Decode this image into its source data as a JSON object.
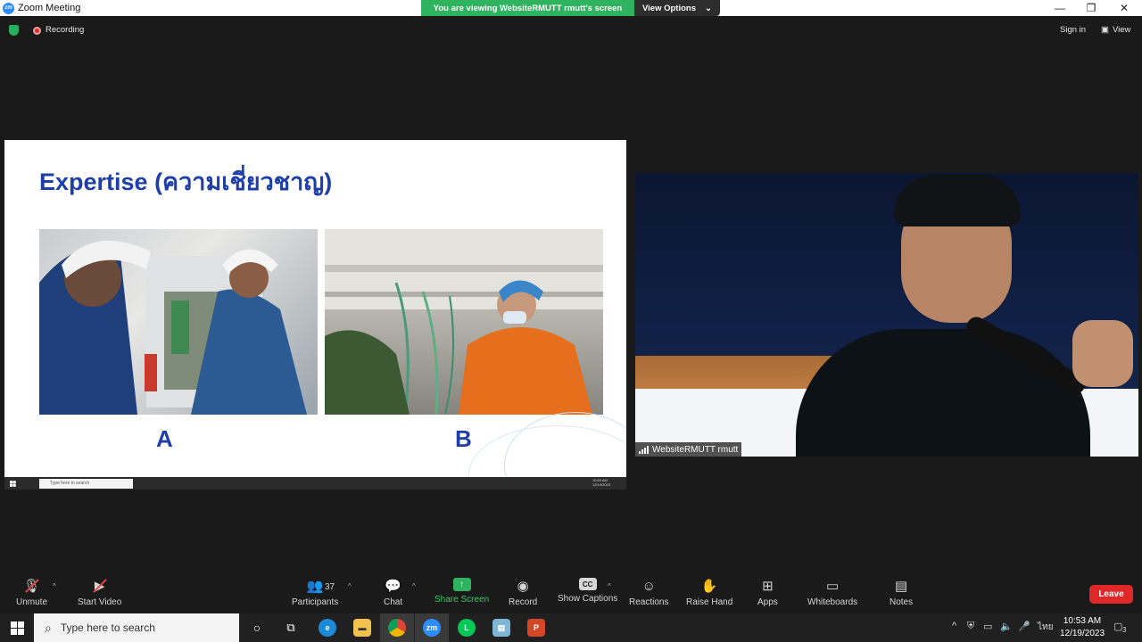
{
  "window": {
    "title": "Zoom Meeting"
  },
  "banner": {
    "viewing_text": "You are viewing WebsiteRMUTT rmutt's screen",
    "view_options_label": "View Options"
  },
  "meeting_header": {
    "recording_label": "Recording",
    "sign_in_label": "Sign in",
    "view_label": "View"
  },
  "shared_slide": {
    "title": "Expertise (ความเชี่ยวชาญ)",
    "label_a": "A",
    "label_b": "B",
    "remote_taskbar": {
      "search_placeholder": "Type here to search",
      "time": "10:53 AM",
      "date": "12/19/2023"
    }
  },
  "video": {
    "participant_name": "WebsiteRMUTT rmutt"
  },
  "toolbar": {
    "unmute": "Unmute",
    "start_video": "Start Video",
    "participants": "Participants",
    "participant_count": "37",
    "chat": "Chat",
    "share_screen": "Share Screen",
    "record": "Record",
    "show_captions": "Show Captions",
    "reactions": "Reactions",
    "raise_hand": "Raise Hand",
    "apps": "Apps",
    "whiteboards": "Whiteboards",
    "notes": "Notes",
    "leave": "Leave"
  },
  "taskbar": {
    "search_placeholder": "Type here to search",
    "language": "ไทย",
    "time": "10:53 AM",
    "date": "12/19/2023",
    "notification_count": "3"
  },
  "colors": {
    "accent_green": "#2fb35f",
    "leave_red": "#e02828",
    "slide_title_blue": "#1e3fa8",
    "zoom_blue": "#2d8cff"
  }
}
